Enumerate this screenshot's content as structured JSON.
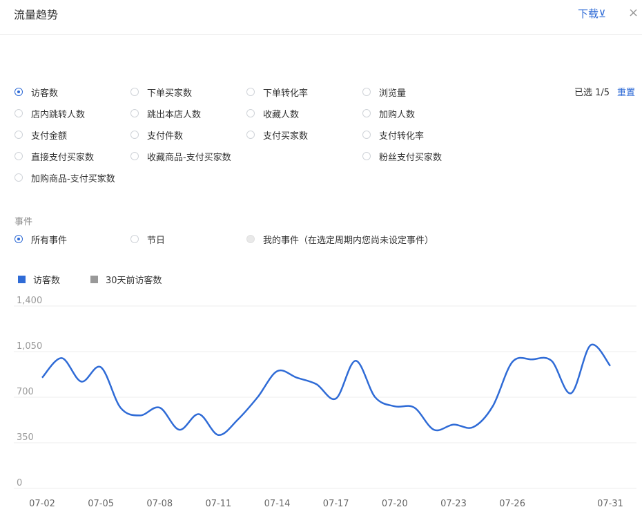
{
  "header": {
    "title": "流量趋势",
    "download_label": "下载⊻",
    "close_label": "×"
  },
  "metrics": {
    "options": [
      {
        "label": "访客数",
        "checked": true
      },
      {
        "label": "下单买家数",
        "checked": false
      },
      {
        "label": "下单转化率",
        "checked": false
      },
      {
        "label": "浏览量",
        "checked": false
      },
      {
        "label": "店内跳转人数",
        "checked": false
      },
      {
        "label": "跳出本店人数",
        "checked": false
      },
      {
        "label": "收藏人数",
        "checked": false
      },
      {
        "label": "加购人数",
        "checked": false
      },
      {
        "label": "支付金额",
        "checked": false
      },
      {
        "label": "支付件数",
        "checked": false
      },
      {
        "label": "支付买家数",
        "checked": false
      },
      {
        "label": "支付转化率",
        "checked": false
      },
      {
        "label": "直接支付买家数",
        "checked": false
      },
      {
        "label": "收藏商品-支付买家数",
        "checked": false
      },
      {
        "label": "粉丝支付买家数",
        "checked": false
      },
      {
        "label": "加购商品-支付买家数",
        "checked": false
      }
    ],
    "selected_text": "已选 1/5",
    "reset_label": "重置"
  },
  "events": {
    "label": "事件",
    "options": [
      {
        "label": "所有事件",
        "checked": true,
        "disabled": false
      },
      {
        "label": "节日",
        "checked": false,
        "disabled": false
      },
      {
        "label": "我的事件（在选定周期内您尚未设定事件）",
        "checked": false,
        "disabled": true
      }
    ]
  },
  "legend": [
    {
      "label": "访客数",
      "color": "#2f6bd6"
    },
    {
      "label": "30天前访客数",
      "color": "#999999"
    }
  ],
  "chart_data": {
    "type": "line",
    "x": [
      "07-02",
      "07-03",
      "07-04",
      "07-05",
      "07-06",
      "07-07",
      "07-08",
      "07-09",
      "07-10",
      "07-11",
      "07-12",
      "07-13",
      "07-14",
      "07-15",
      "07-16",
      "07-17",
      "07-18",
      "07-19",
      "07-20",
      "07-21",
      "07-22",
      "07-23",
      "07-24",
      "07-25",
      "07-26",
      "07-27",
      "07-28",
      "07-29",
      "07-30",
      "07-31"
    ],
    "x_tick_labels": [
      "07-02",
      "07-05",
      "07-08",
      "07-11",
      "07-14",
      "07-17",
      "07-20",
      "07-23",
      "07-26",
      "07-31"
    ],
    "series": [
      {
        "name": "访客数",
        "color": "#2f6bd6",
        "values": [
          850,
          1000,
          820,
          930,
          620,
          560,
          620,
          450,
          570,
          410,
          530,
          700,
          900,
          850,
          800,
          690,
          980,
          700,
          630,
          620,
          450,
          490,
          470,
          630,
          970,
          990,
          980,
          730,
          1100,
          940
        ]
      }
    ],
    "yticks": [
      0,
      350,
      700,
      1050,
      1400
    ],
    "ytick_labels": [
      "0",
      "350",
      "700",
      "1,050",
      "1,400"
    ],
    "ylim": [
      0,
      1400
    ],
    "grid": true,
    "legend_position": "top-left"
  }
}
